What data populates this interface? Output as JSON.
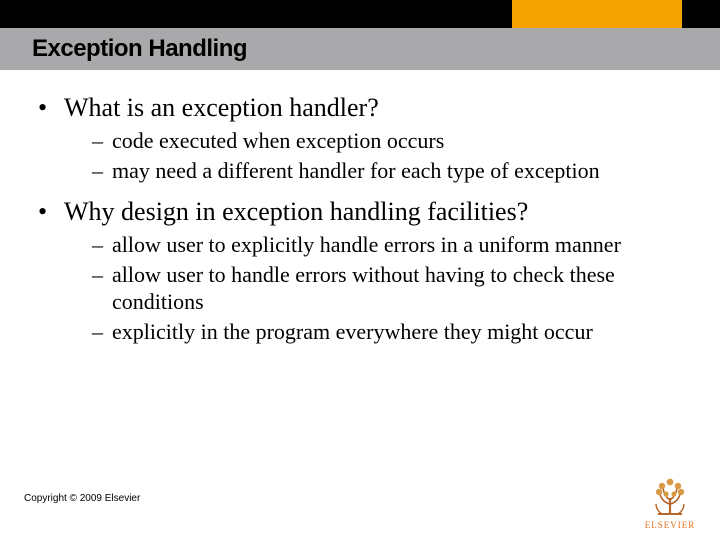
{
  "header": {
    "title": "Exception Handling"
  },
  "bullets": {
    "b1": {
      "text": "What is an exception handler?",
      "subs": {
        "s1": "code executed when exception occurs",
        "s2": "may need a different handler for each type of exception"
      }
    },
    "b2": {
      "text": "Why design in exception handling facilities?",
      "subs": {
        "s1": "allow user to explicitly handle errors in a uniform manner",
        "s2": "allow user to handle errors without having to check these conditions",
        "s3": "explicitly in the program everywhere they might occur"
      }
    }
  },
  "footer": {
    "copyright": "Copyright © 2009 Elsevier",
    "logo_caption": "ELSEVIER"
  }
}
